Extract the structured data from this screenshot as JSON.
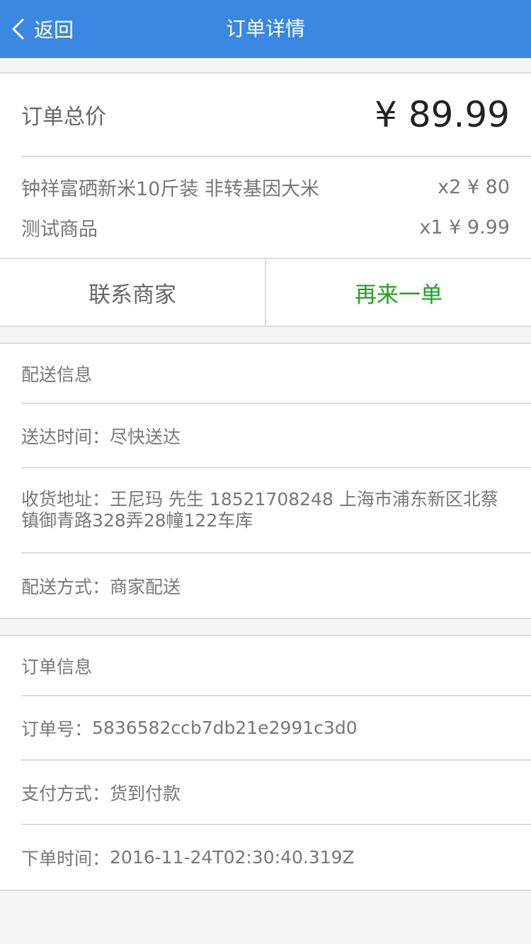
{
  "nav": {
    "back_label": "返回",
    "title": "订单详情",
    "back_icon": "chevron-left-icon"
  },
  "summary": {
    "total_label": "订单总价",
    "total_value": "¥ 89.99",
    "items": [
      {
        "name": "钟祥富硒新米10斤装 非转基因大米",
        "qty_price": "x2 ¥ 80"
      },
      {
        "name": "测试商品",
        "qty_price": "x1 ¥ 9.99"
      }
    ]
  },
  "actions": {
    "contact_label": "联系商家",
    "reorder_label": "再来一单"
  },
  "delivery": {
    "header": "配送信息",
    "time_label": "送达时间：",
    "time_value": "尽快送达",
    "address_label": "收货地址：",
    "address_value": "王尼玛 先生 18521708248 上海市浦东新区北蔡镇御青路328弄28幢122车库",
    "method_label": "配送方式：",
    "method_value": "商家配送"
  },
  "order": {
    "header": "订单信息",
    "number_label": "订单号：",
    "number_value": "5836582ccb7db21e2991c3d0",
    "payment_label": "支付方式：",
    "payment_value": "货到付款",
    "time_label": "下单时间：",
    "time_value": "2016-11-24T02:30:40.319Z"
  },
  "colors": {
    "nav_bg": "#3a88e2",
    "reorder": "#1aa51a"
  }
}
